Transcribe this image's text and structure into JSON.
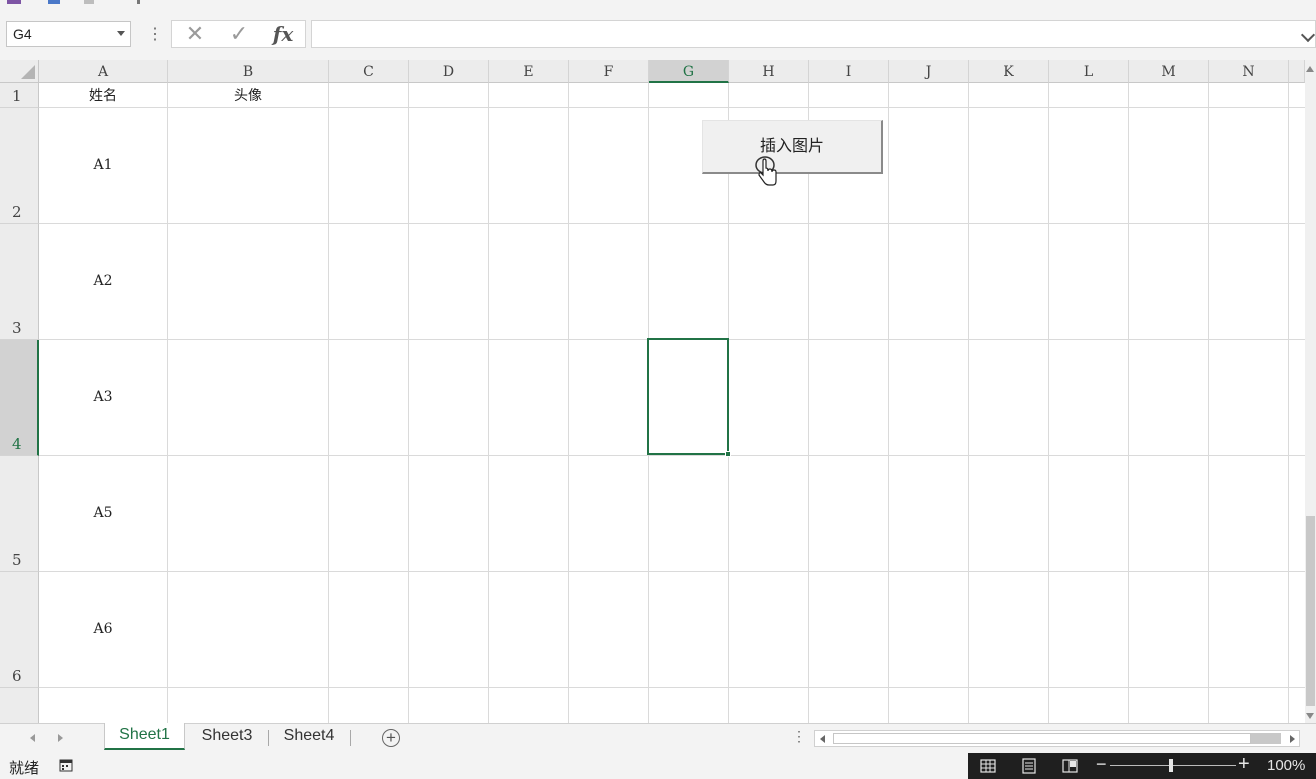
{
  "name_box": {
    "value": "G4"
  },
  "formula_bar": {
    "fx_label": "fx",
    "value": ""
  },
  "columns": [
    "A",
    "B",
    "C",
    "D",
    "E",
    "F",
    "G",
    "H",
    "I",
    "J",
    "K",
    "L",
    "M",
    "N"
  ],
  "selected_column": "G",
  "rows": [
    "1",
    "2",
    "3",
    "4",
    "5",
    "6"
  ],
  "selected_row": "4",
  "cells": {
    "A1": "姓名",
    "B1": "头像",
    "A2": "A1",
    "A3": "A2",
    "A4": "A3",
    "A5": "A5",
    "A6": "A6"
  },
  "form_button": {
    "label": "插入图片"
  },
  "sheet_tabs": [
    {
      "label": "Sheet1",
      "active": true
    },
    {
      "label": "Sheet3",
      "active": false
    },
    {
      "label": "Sheet4",
      "active": false
    }
  ],
  "status_bar": {
    "mode": "就绪",
    "zoom": "100%"
  },
  "colors": {
    "accent": "#217346",
    "header_bg": "#ececec",
    "status_dark": "#1f1f1f"
  },
  "icons": {
    "cancel": "close-icon",
    "enter": "check-icon",
    "function": "fx-icon",
    "add_sheet": "plus-circle-icon",
    "cursor": "hand-pointer-icon"
  }
}
